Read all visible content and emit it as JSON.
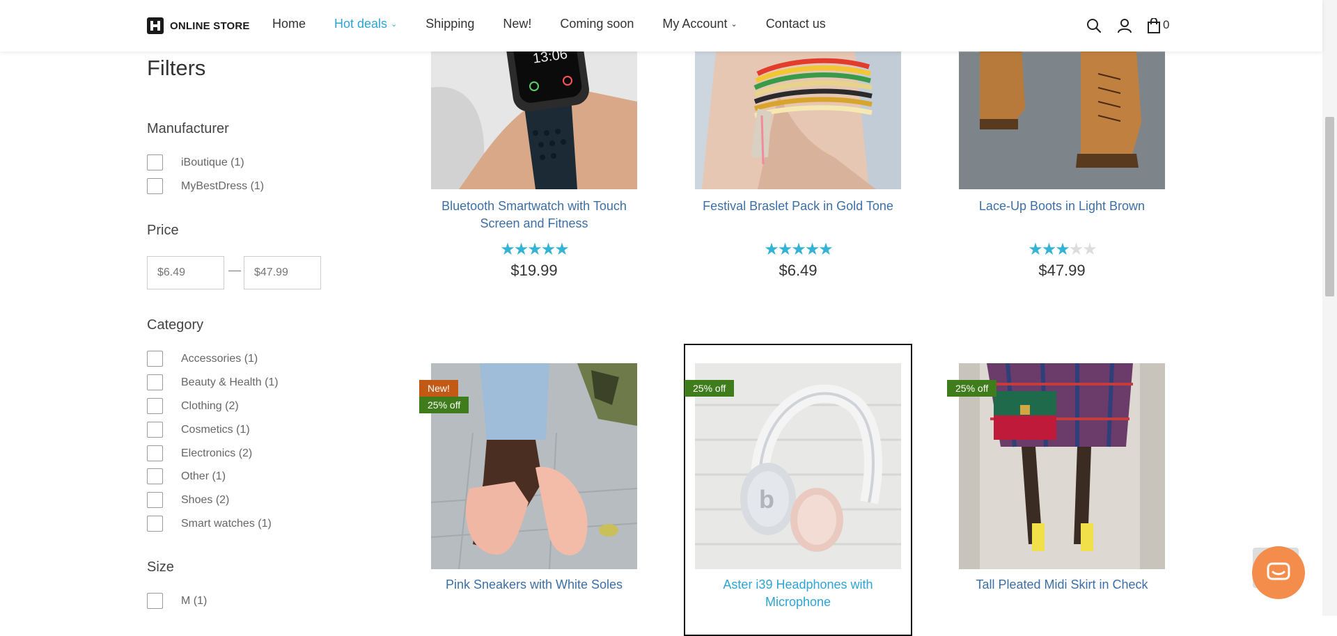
{
  "header": {
    "logo_text": "ONLINE STORE",
    "nav": [
      {
        "label": "Home"
      },
      {
        "label": "Hot deals",
        "dropdown": true,
        "active": true
      },
      {
        "label": "Shipping"
      },
      {
        "label": "New!"
      },
      {
        "label": "Coming soon"
      },
      {
        "label": "My Account",
        "dropdown": true
      },
      {
        "label": "Contact us"
      }
    ],
    "cart_count": "0",
    "accent_color": "#2ea3d5"
  },
  "filters": {
    "title": "Filters",
    "manufacturer": {
      "title": "Manufacturer",
      "options": [
        "iBoutique (1)",
        "MyBestDress (1)"
      ]
    },
    "price": {
      "title": "Price",
      "min_placeholder": "$6.49",
      "max_placeholder": "$47.99",
      "separator": "—"
    },
    "category": {
      "title": "Category",
      "options": [
        "Accessories (1)",
        "Beauty & Health (1)",
        "Clothing (2)",
        "Cosmetics (1)",
        "Electronics (2)",
        "Other (1)",
        "Shoes (2)",
        "Smart watches (1)"
      ]
    },
    "size": {
      "title": "Size",
      "options": [
        "M (1)"
      ]
    }
  },
  "products": [
    {
      "name": "Bluetooth Smartwatch with Touch Screen and Fitness",
      "rating": 5,
      "price": "$19.99",
      "image": "smartwatch-image"
    },
    {
      "name": "Festival Braslet Pack in Gold Tone",
      "rating": 5,
      "price": "$6.49",
      "image": "bracelet-image"
    },
    {
      "name": "Lace-Up Boots in Light Brown",
      "rating": 3,
      "price": "$47.99",
      "image": "boots-image"
    },
    {
      "name": "Pink Sneakers with White Soles",
      "badges": [
        "New!",
        "25% off"
      ],
      "image": "sneakers-image"
    },
    {
      "name": "Aster i39 Headphones with Microphone",
      "badges": [
        "25% off"
      ],
      "image": "headphones-image",
      "focused": true
    },
    {
      "name": "Tall Pleated Midi Skirt in Check",
      "badges": [
        "25% off"
      ],
      "image": "skirt-image"
    }
  ],
  "colors": {
    "star": "#34b3d4",
    "badge_new": "#c25a16",
    "badge_discount": "#3f7d1c",
    "product_link": "#3c6fa6",
    "chat_button": "#f48d4b"
  }
}
